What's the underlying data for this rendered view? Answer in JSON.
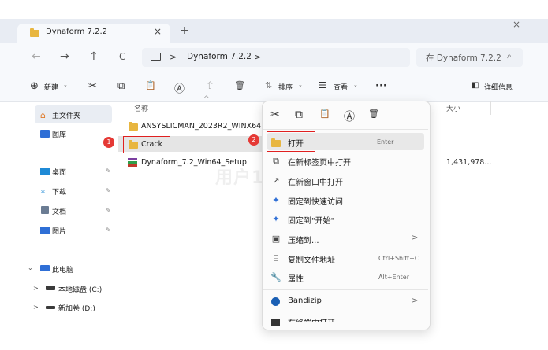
{
  "tab": {
    "title": "Dynaform 7.2.2",
    "close": "×",
    "add": "+"
  },
  "window": {
    "minimize": "−",
    "close": "×"
  },
  "nav": {
    "back": "←",
    "forward": "→",
    "up": "↑",
    "refresh": "C"
  },
  "address": {
    "chev1": ">",
    "path": "Dynaform 7.2.2",
    "chev2": ">"
  },
  "search": {
    "placeholder": "在 Dynaform 7.2.2",
    "icon": "⌕"
  },
  "toolbar": {
    "new_label": "新建",
    "new_icon": "⊕",
    "cut_icon": "✂",
    "copy_icon": "⧉",
    "paste_icon": "📋",
    "rename_icon": "Ⓐ",
    "share_icon": "⇧",
    "delete_icon": "🗑",
    "sort_label": "排序",
    "view_label": "查看",
    "more_label": "···",
    "details_label": "详细信息",
    "caret": "⌄"
  },
  "sidebar": {
    "items": [
      {
        "label": "主文件夹",
        "icon": "home-icon",
        "color": "#e07b2a"
      },
      {
        "label": "图库",
        "icon": "gallery-icon",
        "color": "#2f6fd6"
      },
      {
        "label": "桌面",
        "icon": "desktop-icon",
        "color": "#1f8ad6"
      },
      {
        "label": "下载",
        "icon": "download-icon",
        "color": "#1f8ad6"
      },
      {
        "label": "文档",
        "icon": "document-icon",
        "color": "#6b7c93"
      },
      {
        "label": "图片",
        "icon": "picture-icon",
        "color": "#2f6fd6"
      },
      {
        "label": "此电脑",
        "icon": "pc-icon",
        "color": "#2f6fd6"
      },
      {
        "label": "本地磁盘 (C:)",
        "icon": "drive-icon",
        "color": "#3a3a3a"
      },
      {
        "label": "新加卷 (D:)",
        "icon": "drive-icon",
        "color": "#3a3a3a"
      }
    ],
    "pin": "📌",
    "expand_open": "⌄",
    "expand_closed": ">"
  },
  "columns": {
    "name": "名称",
    "size": "大小",
    "sort_caret": "^"
  },
  "files": [
    {
      "name": "ANSYSLICMAN_2023R2_WINX64",
      "type": "folder",
      "size": ""
    },
    {
      "name": "Crack",
      "type": "folder",
      "size": ""
    },
    {
      "name": "Dynaform_7.2_Win64_Setup",
      "type": "archive",
      "size": "1,431,978..."
    }
  ],
  "context_menu": {
    "top_icons": [
      "✂",
      "⧉",
      "📋",
      "Ⓐ",
      "🗑"
    ],
    "items": [
      {
        "label": "打开",
        "shortcut": "Enter",
        "icon": "folder-open-icon"
      },
      {
        "label": "在新标签页中打开",
        "shortcut": "",
        "icon": "new-tab-icon"
      },
      {
        "label": "在新窗口中打开",
        "shortcut": "",
        "icon": "new-window-icon"
      },
      {
        "label": "固定到快速访问",
        "shortcut": "",
        "icon": "pin-icon"
      },
      {
        "label": "固定到\"开始\"",
        "shortcut": "",
        "icon": "pin-start-icon"
      },
      {
        "label": "压缩到...",
        "shortcut": "",
        "submenu": ">",
        "icon": "compress-icon"
      },
      {
        "label": "复制文件地址",
        "shortcut": "Ctrl+Shift+C",
        "icon": "copy-path-icon"
      },
      {
        "label": "属性",
        "shortcut": "Alt+Enter",
        "icon": "properties-icon"
      },
      {
        "label": "Bandizip",
        "shortcut": "",
        "submenu": ">",
        "icon": "bandizip-icon"
      },
      {
        "label": "在终端中打开",
        "shortcut": "",
        "icon": "terminal-icon"
      }
    ]
  },
  "annotations": {
    "badge1": "1",
    "badge2": "2",
    "color": "#e02020"
  },
  "watermark": "用户11856980"
}
